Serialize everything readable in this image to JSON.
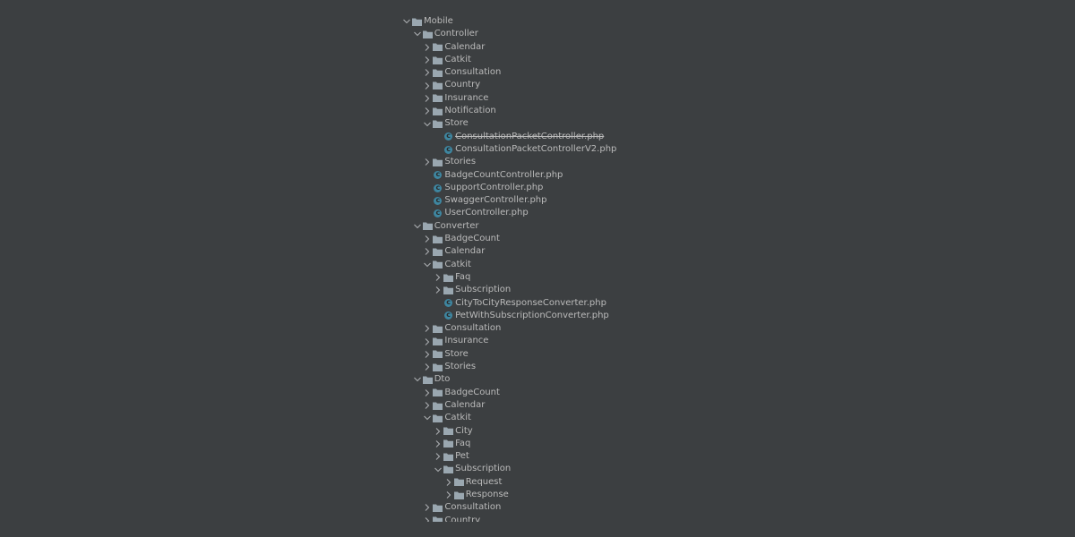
{
  "tree": [
    {
      "label": "Mobile",
      "type": "folder",
      "depth": 0,
      "expanded": true
    },
    {
      "label": "Controller",
      "type": "folder",
      "depth": 1,
      "expanded": true
    },
    {
      "label": "Calendar",
      "type": "folder",
      "depth": 2,
      "expanded": false
    },
    {
      "label": "Catkit",
      "type": "folder",
      "depth": 2,
      "expanded": false
    },
    {
      "label": "Consultation",
      "type": "folder",
      "depth": 2,
      "expanded": false
    },
    {
      "label": "Country",
      "type": "folder",
      "depth": 2,
      "expanded": false
    },
    {
      "label": "Insurance",
      "type": "folder",
      "depth": 2,
      "expanded": false
    },
    {
      "label": "Notification",
      "type": "folder",
      "depth": 2,
      "expanded": false
    },
    {
      "label": "Store",
      "type": "folder",
      "depth": 2,
      "expanded": true
    },
    {
      "label": "ConsultationPacketController.php",
      "type": "class-file",
      "depth": 3,
      "deprecated": true
    },
    {
      "label": "ConsultationPacketControllerV2.php",
      "type": "class-file",
      "depth": 3
    },
    {
      "label": "Stories",
      "type": "folder",
      "depth": 2,
      "expanded": false
    },
    {
      "label": "BadgeCountController.php",
      "type": "class-file",
      "depth": 2
    },
    {
      "label": "SupportController.php",
      "type": "class-file",
      "depth": 2
    },
    {
      "label": "SwaggerController.php",
      "type": "class-file",
      "depth": 2
    },
    {
      "label": "UserController.php",
      "type": "class-file",
      "depth": 2
    },
    {
      "label": "Converter",
      "type": "folder",
      "depth": 1,
      "expanded": true
    },
    {
      "label": "BadgeCount",
      "type": "folder",
      "depth": 2,
      "expanded": false
    },
    {
      "label": "Calendar",
      "type": "folder",
      "depth": 2,
      "expanded": false
    },
    {
      "label": "Catkit",
      "type": "folder",
      "depth": 2,
      "expanded": true
    },
    {
      "label": "Faq",
      "type": "folder",
      "depth": 3,
      "expanded": false
    },
    {
      "label": "Subscription",
      "type": "folder",
      "depth": 3,
      "expanded": false
    },
    {
      "label": "CityToCityResponseConverter.php",
      "type": "class-file",
      "depth": 3
    },
    {
      "label": "PetWithSubscriptionConverter.php",
      "type": "class-file",
      "depth": 3
    },
    {
      "label": "Consultation",
      "type": "folder",
      "depth": 2,
      "expanded": false
    },
    {
      "label": "Insurance",
      "type": "folder",
      "depth": 2,
      "expanded": false
    },
    {
      "label": "Store",
      "type": "folder",
      "depth": 2,
      "expanded": false
    },
    {
      "label": "Stories",
      "type": "folder",
      "depth": 2,
      "expanded": false
    },
    {
      "label": "Dto",
      "type": "folder",
      "depth": 1,
      "expanded": true
    },
    {
      "label": "BadgeCount",
      "type": "folder",
      "depth": 2,
      "expanded": false
    },
    {
      "label": "Calendar",
      "type": "folder",
      "depth": 2,
      "expanded": false
    },
    {
      "label": "Catkit",
      "type": "folder",
      "depth": 2,
      "expanded": true
    },
    {
      "label": "City",
      "type": "folder",
      "depth": 3,
      "expanded": false
    },
    {
      "label": "Faq",
      "type": "folder",
      "depth": 3,
      "expanded": false
    },
    {
      "label": "Pet",
      "type": "folder",
      "depth": 3,
      "expanded": false
    },
    {
      "label": "Subscription",
      "type": "folder",
      "depth": 3,
      "expanded": true
    },
    {
      "label": "Request",
      "type": "folder",
      "depth": 4,
      "expanded": false
    },
    {
      "label": "Response",
      "type": "folder",
      "depth": 4,
      "expanded": false
    },
    {
      "label": "Consultation",
      "type": "folder",
      "depth": 2,
      "expanded": false
    },
    {
      "label": "Country",
      "type": "folder",
      "depth": 2,
      "expanded": false
    }
  ],
  "colors": {
    "background": "#3c3f41",
    "text": "#bbbbbb",
    "folder": "#9aa7b0",
    "class_icon": "#3e86a0"
  }
}
